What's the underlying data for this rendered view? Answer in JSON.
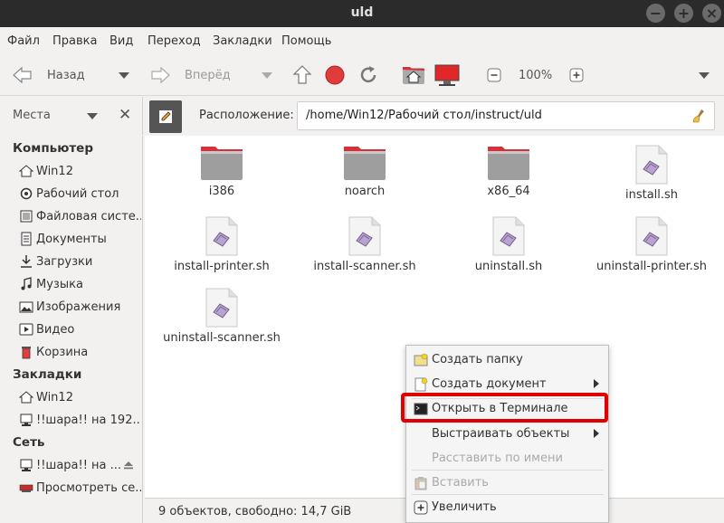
{
  "window": {
    "title": "uld"
  },
  "menubar": [
    "Файл",
    "Правка",
    "Вид",
    "Переход",
    "Закладки",
    "Помощь"
  ],
  "toolbar": {
    "back_label": "Назад",
    "forward_label": "Вперёд",
    "zoom": "100%"
  },
  "sidebar_header": {
    "label": "Места"
  },
  "location": {
    "label": "Расположение:",
    "path": "/home/Win12/Рабочий стол/instruct/uld"
  },
  "sidebar": {
    "computer_heading": "Компьютер",
    "computer_items": [
      {
        "label": "Win12",
        "icon": "home-icon"
      },
      {
        "label": "Рабочий стол",
        "icon": "desktop-icon"
      },
      {
        "label": "Файловая систе...",
        "icon": "drive-icon"
      },
      {
        "label": "Документы",
        "icon": "documents-icon"
      },
      {
        "label": "Загрузки",
        "icon": "downloads-icon"
      },
      {
        "label": "Музыка",
        "icon": "music-icon"
      },
      {
        "label": "Изображения",
        "icon": "pictures-icon"
      },
      {
        "label": "Видео",
        "icon": "video-icon"
      },
      {
        "label": "Корзина",
        "icon": "trash-icon"
      }
    ],
    "bookmarks_heading": "Закладки",
    "bookmark_items": [
      {
        "label": "Win12",
        "icon": "home-icon"
      },
      {
        "label": "!!шара!! на 192....",
        "icon": "network-share-icon"
      }
    ],
    "network_heading": "Сеть",
    "network_items": [
      {
        "label": "!!шара!! на ...",
        "icon": "network-share-icon"
      },
      {
        "label": "Просмотреть се...",
        "icon": "network-icon"
      }
    ]
  },
  "files": [
    {
      "name": "i386",
      "type": "folder"
    },
    {
      "name": "noarch",
      "type": "folder"
    },
    {
      "name": "x86_64",
      "type": "folder"
    },
    {
      "name": "install.sh",
      "type": "script"
    },
    {
      "name": "install-printer.sh",
      "type": "script"
    },
    {
      "name": "install-scanner.sh",
      "type": "script"
    },
    {
      "name": "uninstall.sh",
      "type": "script"
    },
    {
      "name": "uninstall-printer.sh",
      "type": "script"
    },
    {
      "name": "uninstall-scanner.sh",
      "type": "script"
    }
  ],
  "status": {
    "text": "9 объектов, свободно: 14,7 GiB"
  },
  "context_menu": {
    "items": [
      {
        "label": "Создать папку",
        "enabled": true,
        "submenu": false
      },
      {
        "label": "Создать документ",
        "enabled": true,
        "submenu": true
      },
      {
        "label": "Открыть в Терминале",
        "enabled": true,
        "submenu": false,
        "highlighted": true
      },
      {
        "label": "Выстраивать объекты",
        "enabled": true,
        "submenu": true
      },
      {
        "label": "Расставить по имени",
        "enabled": false,
        "submenu": false
      },
      {
        "label": "Вставить",
        "enabled": false,
        "submenu": false
      },
      {
        "label": "Увеличить",
        "enabled": true,
        "submenu": false
      }
    ]
  },
  "colors": {
    "folder_red": "#d8303a",
    "folder_gray": "#9e9e9e",
    "highlight": "#e00000",
    "script_purple": "#9b7fb8"
  }
}
